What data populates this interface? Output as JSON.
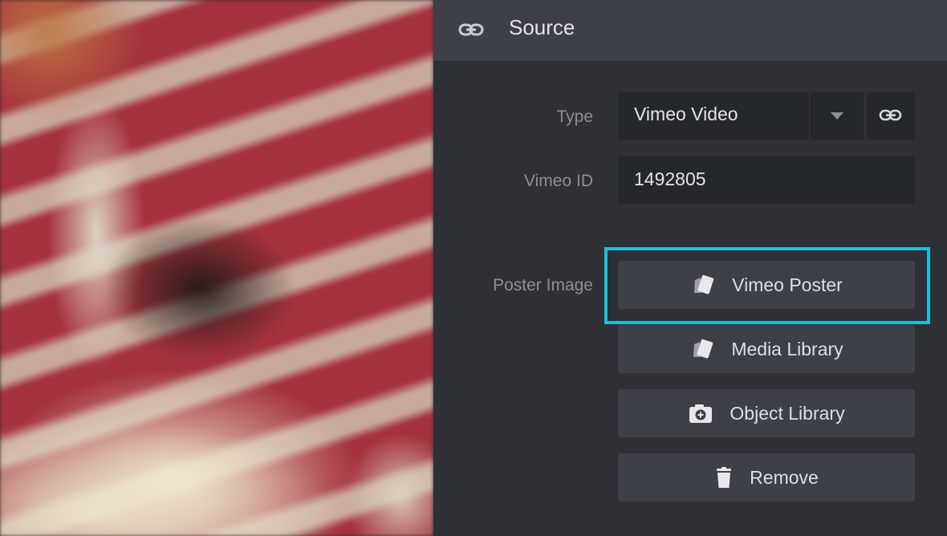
{
  "header": {
    "title": "Source",
    "icon": "link-icon"
  },
  "fields": {
    "type": {
      "label": "Type",
      "value": "Vimeo Video"
    },
    "vimeo_id": {
      "label": "Vimeo ID",
      "value": "1492805"
    },
    "poster": {
      "label": "Poster Image"
    }
  },
  "buttons": {
    "vimeo_poster": {
      "label": "Vimeo Poster",
      "icon": "image-icon"
    },
    "media_library": {
      "label": "Media Library",
      "icon": "image-icon"
    },
    "object_library": {
      "label": "Object Library",
      "icon": "camera-plus-icon"
    },
    "remove": {
      "label": "Remove",
      "icon": "trash-icon"
    }
  },
  "colors": {
    "accent_highlight": "#19c0de",
    "panel_bg": "#2e3035",
    "header_bg": "#3d4047"
  }
}
